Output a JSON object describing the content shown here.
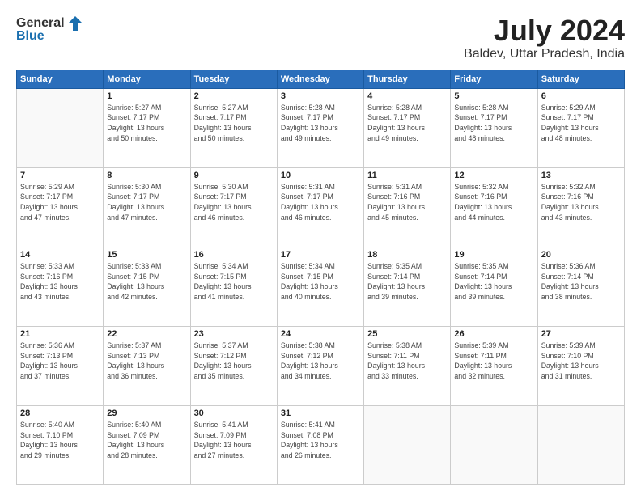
{
  "header": {
    "logo_general": "General",
    "logo_blue": "Blue",
    "title": "July 2024",
    "subtitle": "Baldev, Uttar Pradesh, India"
  },
  "weekdays": [
    "Sunday",
    "Monday",
    "Tuesday",
    "Wednesday",
    "Thursday",
    "Friday",
    "Saturday"
  ],
  "weeks": [
    [
      {
        "day": "",
        "info": ""
      },
      {
        "day": "1",
        "info": "Sunrise: 5:27 AM\nSunset: 7:17 PM\nDaylight: 13 hours\nand 50 minutes."
      },
      {
        "day": "2",
        "info": "Sunrise: 5:27 AM\nSunset: 7:17 PM\nDaylight: 13 hours\nand 50 minutes."
      },
      {
        "day": "3",
        "info": "Sunrise: 5:28 AM\nSunset: 7:17 PM\nDaylight: 13 hours\nand 49 minutes."
      },
      {
        "day": "4",
        "info": "Sunrise: 5:28 AM\nSunset: 7:17 PM\nDaylight: 13 hours\nand 49 minutes."
      },
      {
        "day": "5",
        "info": "Sunrise: 5:28 AM\nSunset: 7:17 PM\nDaylight: 13 hours\nand 48 minutes."
      },
      {
        "day": "6",
        "info": "Sunrise: 5:29 AM\nSunset: 7:17 PM\nDaylight: 13 hours\nand 48 minutes."
      }
    ],
    [
      {
        "day": "7",
        "info": "Sunrise: 5:29 AM\nSunset: 7:17 PM\nDaylight: 13 hours\nand 47 minutes."
      },
      {
        "day": "8",
        "info": "Sunrise: 5:30 AM\nSunset: 7:17 PM\nDaylight: 13 hours\nand 47 minutes."
      },
      {
        "day": "9",
        "info": "Sunrise: 5:30 AM\nSunset: 7:17 PM\nDaylight: 13 hours\nand 46 minutes."
      },
      {
        "day": "10",
        "info": "Sunrise: 5:31 AM\nSunset: 7:17 PM\nDaylight: 13 hours\nand 46 minutes."
      },
      {
        "day": "11",
        "info": "Sunrise: 5:31 AM\nSunset: 7:16 PM\nDaylight: 13 hours\nand 45 minutes."
      },
      {
        "day": "12",
        "info": "Sunrise: 5:32 AM\nSunset: 7:16 PM\nDaylight: 13 hours\nand 44 minutes."
      },
      {
        "day": "13",
        "info": "Sunrise: 5:32 AM\nSunset: 7:16 PM\nDaylight: 13 hours\nand 43 minutes."
      }
    ],
    [
      {
        "day": "14",
        "info": "Sunrise: 5:33 AM\nSunset: 7:16 PM\nDaylight: 13 hours\nand 43 minutes."
      },
      {
        "day": "15",
        "info": "Sunrise: 5:33 AM\nSunset: 7:15 PM\nDaylight: 13 hours\nand 42 minutes."
      },
      {
        "day": "16",
        "info": "Sunrise: 5:34 AM\nSunset: 7:15 PM\nDaylight: 13 hours\nand 41 minutes."
      },
      {
        "day": "17",
        "info": "Sunrise: 5:34 AM\nSunset: 7:15 PM\nDaylight: 13 hours\nand 40 minutes."
      },
      {
        "day": "18",
        "info": "Sunrise: 5:35 AM\nSunset: 7:14 PM\nDaylight: 13 hours\nand 39 minutes."
      },
      {
        "day": "19",
        "info": "Sunrise: 5:35 AM\nSunset: 7:14 PM\nDaylight: 13 hours\nand 39 minutes."
      },
      {
        "day": "20",
        "info": "Sunrise: 5:36 AM\nSunset: 7:14 PM\nDaylight: 13 hours\nand 38 minutes."
      }
    ],
    [
      {
        "day": "21",
        "info": "Sunrise: 5:36 AM\nSunset: 7:13 PM\nDaylight: 13 hours\nand 37 minutes."
      },
      {
        "day": "22",
        "info": "Sunrise: 5:37 AM\nSunset: 7:13 PM\nDaylight: 13 hours\nand 36 minutes."
      },
      {
        "day": "23",
        "info": "Sunrise: 5:37 AM\nSunset: 7:12 PM\nDaylight: 13 hours\nand 35 minutes."
      },
      {
        "day": "24",
        "info": "Sunrise: 5:38 AM\nSunset: 7:12 PM\nDaylight: 13 hours\nand 34 minutes."
      },
      {
        "day": "25",
        "info": "Sunrise: 5:38 AM\nSunset: 7:11 PM\nDaylight: 13 hours\nand 33 minutes."
      },
      {
        "day": "26",
        "info": "Sunrise: 5:39 AM\nSunset: 7:11 PM\nDaylight: 13 hours\nand 32 minutes."
      },
      {
        "day": "27",
        "info": "Sunrise: 5:39 AM\nSunset: 7:10 PM\nDaylight: 13 hours\nand 31 minutes."
      }
    ],
    [
      {
        "day": "28",
        "info": "Sunrise: 5:40 AM\nSunset: 7:10 PM\nDaylight: 13 hours\nand 29 minutes."
      },
      {
        "day": "29",
        "info": "Sunrise: 5:40 AM\nSunset: 7:09 PM\nDaylight: 13 hours\nand 28 minutes."
      },
      {
        "day": "30",
        "info": "Sunrise: 5:41 AM\nSunset: 7:09 PM\nDaylight: 13 hours\nand 27 minutes."
      },
      {
        "day": "31",
        "info": "Sunrise: 5:41 AM\nSunset: 7:08 PM\nDaylight: 13 hours\nand 26 minutes."
      },
      {
        "day": "",
        "info": ""
      },
      {
        "day": "",
        "info": ""
      },
      {
        "day": "",
        "info": ""
      }
    ]
  ]
}
